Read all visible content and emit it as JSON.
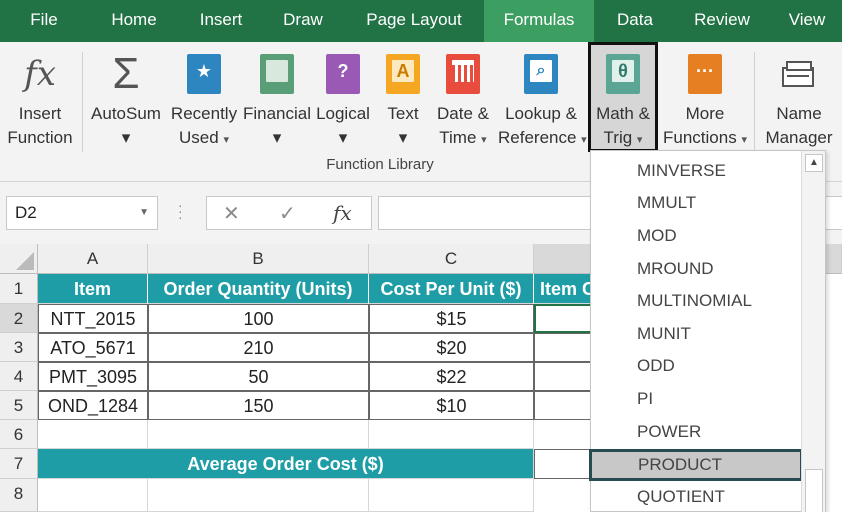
{
  "tabs": [
    "File",
    "Home",
    "Insert",
    "Draw",
    "Page Layout",
    "Formulas",
    "Data",
    "Review",
    "View"
  ],
  "active_tab": "Formulas",
  "ribbon": {
    "insert_function": [
      "Insert",
      "Function"
    ],
    "autosum": "AutoSum",
    "recently_used": [
      "Recently",
      "Used"
    ],
    "financial": "Financial",
    "logical": "Logical",
    "text": "Text",
    "date_time": [
      "Date &",
      "Time"
    ],
    "lookup_reference": [
      "Lookup &",
      "Reference"
    ],
    "math_trig": [
      "Math &",
      "Trig"
    ],
    "more_functions": [
      "More",
      "Functions"
    ],
    "name_manager": [
      "Name",
      "Manager"
    ],
    "group_label": "Function Library",
    "caret": "▾",
    "fx_glyph": "fx",
    "sigma_glyph": "Σ",
    "star_glyph": "★",
    "question_glyph": "?",
    "text_glyph": "A",
    "theta_glyph": "θ",
    "dots_glyph": "···"
  },
  "formula_bar": {
    "name_box": "D2",
    "cancel_glyph": "✕",
    "enter_glyph": "✓",
    "fx_glyph": "fx"
  },
  "grid": {
    "columns": [
      "A",
      "B",
      "C"
    ],
    "rows": [
      "1",
      "2",
      "3",
      "4",
      "5",
      "6",
      "7",
      "8"
    ],
    "headers": [
      "Item",
      "Order Quantity (Units)",
      "Cost Per Unit ($)",
      "Item C"
    ],
    "data": [
      [
        "NTT_2015",
        "100",
        "$15"
      ],
      [
        "ATO_5671",
        "210",
        "$20"
      ],
      [
        "PMT_3095",
        "50",
        "$22"
      ],
      [
        "OND_1284",
        "150",
        "$10"
      ]
    ],
    "average_label": "Average Order Cost ($)"
  },
  "dropdown": {
    "items": [
      "MINVERSE",
      "MMULT",
      "MOD",
      "MROUND",
      "MULTINOMIAL",
      "MUNIT",
      "ODD",
      "PI",
      "POWER",
      "PRODUCT",
      "QUOTIENT"
    ],
    "selected": "PRODUCT"
  },
  "colors": {
    "ribbon_green": "#217346",
    "teal_header": "#1e9da6",
    "financial": "#2e8b57",
    "logical": "#8e44ad",
    "text": "#f39c12",
    "date": "#e74c3c",
    "lookup": "#2e86c1",
    "math": "#1abc9c",
    "more": "#e67e22"
  }
}
